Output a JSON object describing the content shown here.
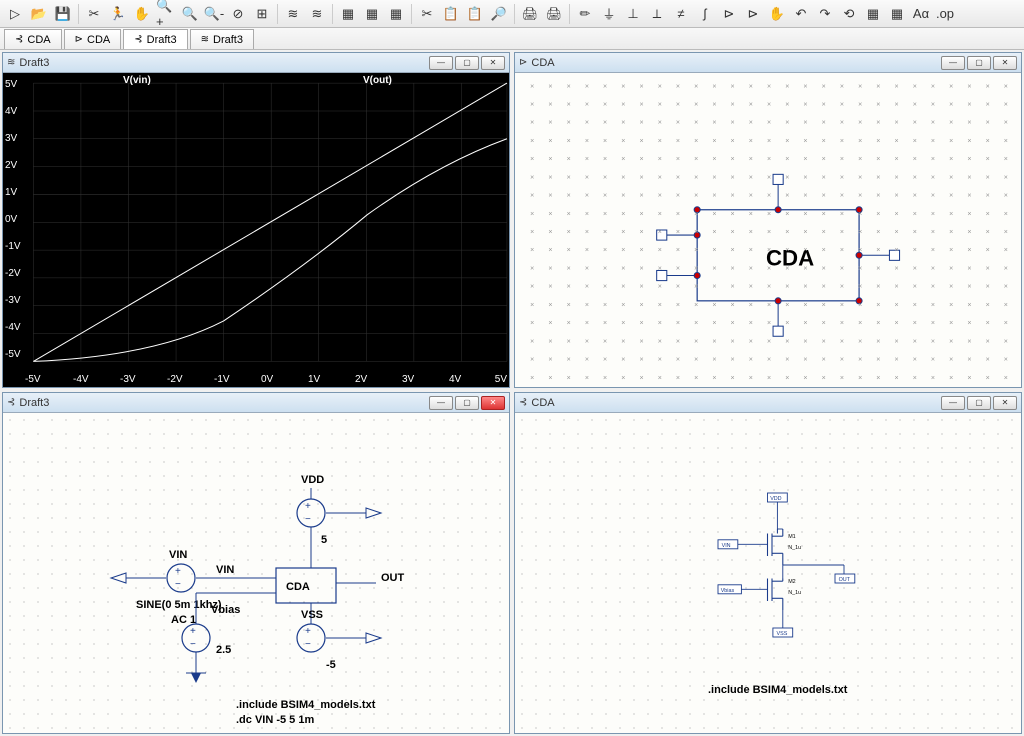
{
  "toolbar_icons": [
    "▷",
    "📂",
    "💾",
    "✂",
    "🏃",
    "✋",
    "🔍+",
    "🔍",
    "🔍-",
    "⊘",
    "⊞",
    "≋",
    "≋",
    "▦",
    "▦",
    "▦",
    "✂",
    "📋",
    "📋",
    "🔎",
    "🖨",
    "🖨",
    "✏",
    "⏚",
    "⊥",
    "⟂",
    "≠",
    "ʃ",
    "⊳",
    "⊳",
    "✋",
    "↶",
    "↷",
    "⟲",
    "▦",
    "▦",
    "Aα",
    ".op"
  ],
  "tabs": [
    {
      "icon": "⊰",
      "label": "CDA"
    },
    {
      "icon": "⊳",
      "label": "CDA"
    },
    {
      "icon": "⊰",
      "label": "Draft3"
    },
    {
      "icon": "≋",
      "label": "Draft3"
    }
  ],
  "windows": {
    "top_left": {
      "title": "Draft3",
      "type": "plot"
    },
    "top_right": {
      "title": "CDA",
      "type": "symbol"
    },
    "bottom_left": {
      "title": "Draft3",
      "type": "schematic_main"
    },
    "bottom_right": {
      "title": "CDA",
      "type": "schematic_sub"
    }
  },
  "plot": {
    "traces": [
      "V(vin)",
      "V(out)"
    ],
    "x_ticks": [
      "-5V",
      "-4V",
      "-3V",
      "-2V",
      "-1V",
      "0V",
      "1V",
      "2V",
      "3V",
      "4V",
      "5V"
    ],
    "y_ticks": [
      "5V",
      "4V",
      "3V",
      "2V",
      "1V",
      "0V",
      "-1V",
      "-2V",
      "-3V",
      "-4V",
      "-5V"
    ]
  },
  "symbol": {
    "name": "CDA"
  },
  "schematic_main": {
    "block": "CDA",
    "nets": {
      "vin": "VIN",
      "vdd": "VDD",
      "vss": "VSS",
      "out": "OUT",
      "vbias": "Vbias"
    },
    "sources": {
      "vin_val": "SINE(0 5m 1khz)",
      "vin_ac": "AC 1",
      "vdd_val": "5",
      "vss_val": "-5",
      "vbias_val": "2.5"
    },
    "directives": [
      ".include BSIM4_models.txt",
      ".dc VIN -5 5 1m"
    ]
  },
  "schematic_sub": {
    "ports": [
      "VDD",
      "VIN",
      "OUT",
      "Vbias",
      "VSS"
    ],
    "devices": [
      {
        "name": "M1",
        "size": "N_1u"
      },
      {
        "name": "M2",
        "size": "N_1u"
      }
    ],
    "directive": ".include BSIM4_models.txt"
  },
  "chart_data": {
    "type": "line",
    "title": "",
    "xlabel": "",
    "ylabel": "",
    "xlim": [
      -5,
      5
    ],
    "ylim": [
      -5,
      5
    ],
    "x": [
      -5,
      -4,
      -3,
      -2,
      -1,
      0,
      1,
      2,
      3,
      4,
      5
    ],
    "series": [
      {
        "name": "V(vin)",
        "values": [
          -5,
          -4,
          -3,
          -2,
          -1,
          0,
          1,
          2,
          3,
          4,
          5
        ]
      },
      {
        "name": "V(out)",
        "values": [
          -5.0,
          -4.9,
          -4.6,
          -4.0,
          -3.2,
          -2.3,
          -1.3,
          -0.3,
          0.8,
          1.9,
          3.0
        ]
      }
    ]
  }
}
